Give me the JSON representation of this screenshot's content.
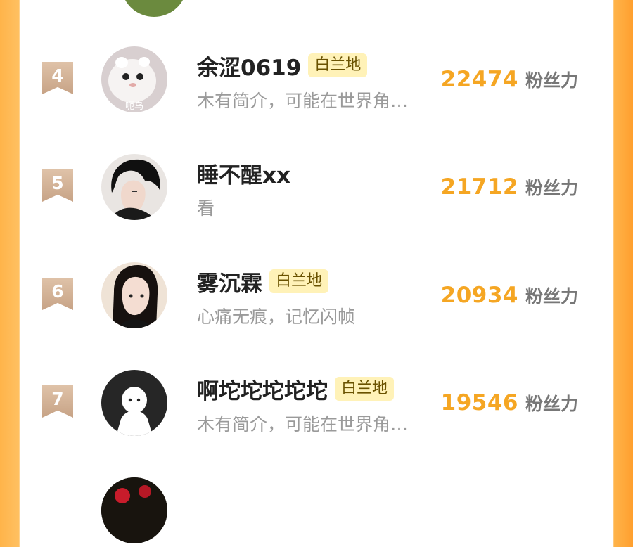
{
  "ranking": {
    "items": [
      {
        "rank": "4",
        "name": "余涩0619",
        "tag": "白兰地",
        "description": "木有简介，可能在世界角…",
        "score": "22474",
        "unit": "粉丝力",
        "avatar_text": "呃乌"
      },
      {
        "rank": "5",
        "name": "睡不醒xx",
        "tag": "",
        "description": "看",
        "score": "21712",
        "unit": "粉丝力"
      },
      {
        "rank": "6",
        "name": "雾沉霖",
        "tag": "白兰地",
        "description": "心痛无痕，记忆闪帧",
        "score": "20934",
        "unit": "粉丝力"
      },
      {
        "rank": "7",
        "name": "啊坨坨坨坨坨",
        "tag": "白兰地",
        "description": "木有简介，可能在世界角…",
        "score": "19546",
        "unit": "粉丝力"
      }
    ]
  },
  "icons": {
    "rank_badge": "ribbon-badge-icon",
    "default_avatar": "default-user-icon"
  },
  "colors": {
    "score": "#f5a623",
    "tag_background": "#fff2b8",
    "rank_badge": "#d4b08f"
  }
}
